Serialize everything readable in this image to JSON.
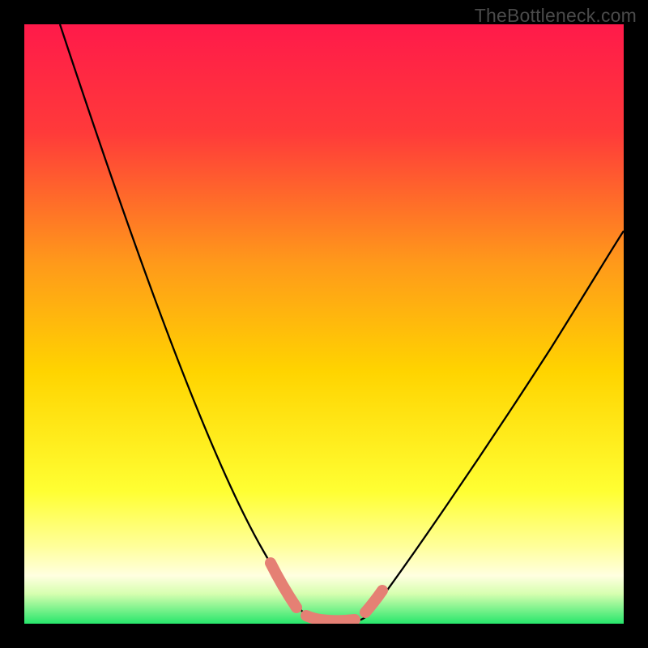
{
  "watermark": "TheBottleneck.com",
  "colors": {
    "frame": "#000000",
    "gradient_top": "#ff1a4a",
    "gradient_upper_mid": "#ff6a2a",
    "gradient_mid": "#ffd400",
    "gradient_lower_mid": "#ffff66",
    "gradient_pale": "#ffffcc",
    "gradient_bottom": "#27e66b",
    "curve": "#000000",
    "marker": "#e58074"
  },
  "chart_data": {
    "type": "line",
    "title": "",
    "xlabel": "",
    "ylabel": "",
    "xlim": [
      0,
      100
    ],
    "ylim": [
      0,
      100
    ],
    "series": [
      {
        "name": "bottleneck-curve",
        "x": [
          6,
          10,
          15,
          20,
          25,
          30,
          35,
          38,
          40,
          42,
          44,
          46,
          48,
          50,
          52,
          54,
          56,
          60,
          65,
          70,
          75,
          80,
          85,
          90,
          95,
          100
        ],
        "y": [
          100,
          90,
          78,
          66,
          54,
          42,
          30,
          20,
          14,
          8,
          4,
          1,
          0,
          0,
          0,
          1,
          3,
          8,
          15,
          22,
          29,
          36,
          43,
          49,
          54,
          58
        ]
      }
    ],
    "markers": [
      {
        "name": "left-segment",
        "x_range": [
          40,
          44
        ],
        "y_range": [
          4,
          14
        ]
      },
      {
        "name": "bottom-segment",
        "x_range": [
          44,
          54
        ],
        "y_range": [
          0,
          1
        ]
      },
      {
        "name": "right-segment",
        "x_range": [
          54,
          57
        ],
        "y_range": [
          1,
          5
        ]
      }
    ],
    "legend": null,
    "grid": false
  }
}
